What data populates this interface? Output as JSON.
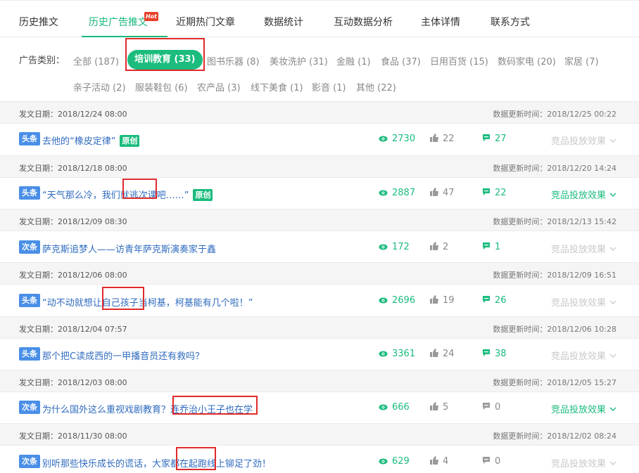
{
  "tabs": [
    {
      "label": "历史推文"
    },
    {
      "label": "历史广告推文"
    },
    {
      "label": "近期热门文章"
    },
    {
      "label": "数据统计"
    },
    {
      "label": "互动数据分析"
    },
    {
      "label": "主体详情"
    },
    {
      "label": "联系方式"
    }
  ],
  "hot_badge": "Hot",
  "category_label": "广告类别：",
  "categories": [
    {
      "label": "全部 (187)"
    },
    {
      "label": "培训教育 (33)"
    },
    {
      "label": "图书乐器 (8)"
    },
    {
      "label": "美妆洗护 (31)"
    },
    {
      "label": "金融 (1)"
    },
    {
      "label": "食品 (37)"
    },
    {
      "label": "日用百货 (15)"
    },
    {
      "label": "数码家电 (20)"
    },
    {
      "label": "家居 (7)"
    },
    {
      "label": "亲子活动 (2)"
    },
    {
      "label": "服装鞋包 (6)"
    },
    {
      "label": "农产品 (3)"
    },
    {
      "label": "线下美食 (1)"
    },
    {
      "label": "影音 (1)"
    },
    {
      "label": "其他 (22)"
    }
  ],
  "articles": [
    {
      "pub": "发文日期：2018/12/24 08:00",
      "upd": "数据更新时间：2018/12/25 00:22",
      "badge": "头条",
      "title": "去他的“橡皮定律”",
      "original": "原创",
      "views": "2730",
      "likes": "22",
      "comments": "27",
      "effect": "竞品投放效果"
    },
    {
      "pub": "发文日期：2018/12/18 08:00",
      "upd": "数据更新时间：2018/12/20 14:24",
      "badge": "头条",
      "title": "“天气那么冷，我们就逃次课吧……”",
      "original": "原创",
      "views": "2887",
      "likes": "47",
      "comments": "22",
      "effect": "竞品投放效果"
    },
    {
      "pub": "发文日期：2018/12/09 08:30",
      "upd": "数据更新时间：2018/12/13 15:42",
      "badge": "次条",
      "title": "萨克斯追梦人——访青年萨克斯演奏家于鑫",
      "original": "",
      "views": "172",
      "likes": "2",
      "comments": "1",
      "effect": "竞品投放效果"
    },
    {
      "pub": "发文日期：2018/12/06 08:00",
      "upd": "数据更新时间：2018/12/09 16:51",
      "badge": "头条",
      "title": "“动不动就想让自己孩子当柯基，柯基能有几个啦！”",
      "original": "",
      "views": "2696",
      "likes": "19",
      "comments": "26",
      "effect": "竞品投放效果"
    },
    {
      "pub": "发文日期：2018/12/04 07:57",
      "upd": "数据更新时间：2018/12/06 10:28",
      "badge": "头条",
      "title": "那个把C读成西的一甲播音员还有救吗？",
      "original": "",
      "views": "3361",
      "likes": "24",
      "comments": "38",
      "effect": "竞品投放效果"
    },
    {
      "pub": "发文日期：2018/12/03 08:00",
      "upd": "数据更新时间：2018/12/05 15:27",
      "badge": "次条",
      "title": "为什么国外这么重视戏剧教育？连乔治小王子也在学",
      "original": "",
      "views": "666",
      "likes": "5",
      "comments": "0",
      "effect": "竞品投放效果"
    },
    {
      "pub": "发文日期：2018/11/30 08:00",
      "upd": "数据更新时间：2018/12/02 08:24",
      "badge": "次条",
      "title": "别听那些快乐成长的谎话，大家都在起跑线上铆足了劲！",
      "original": "",
      "views": "629",
      "likes": "4",
      "comments": "0",
      "effect": "竞品投放效果"
    }
  ],
  "colors": {
    "accent": "#1bbc7d",
    "link": "#2f6bbf",
    "badge": "#4a8fe7",
    "highlight_box": "#e02a2a"
  }
}
